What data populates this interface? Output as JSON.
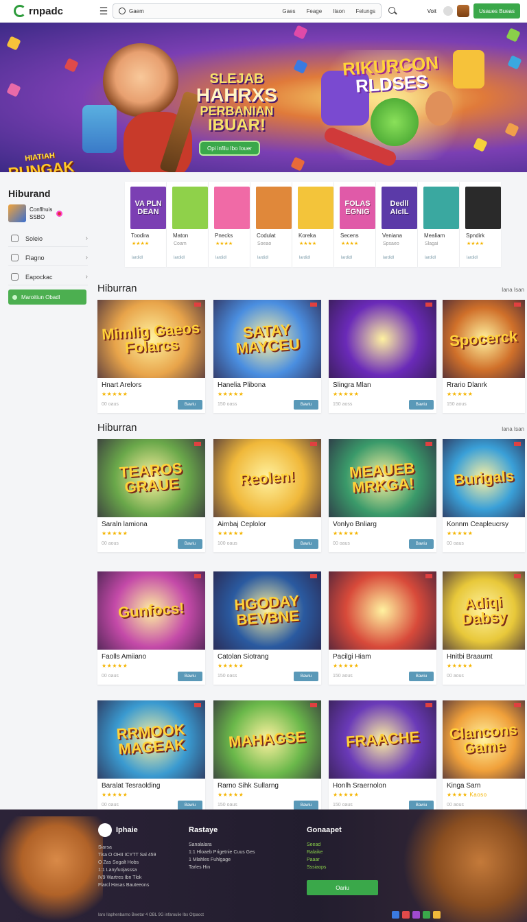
{
  "header": {
    "brand": "rnpadc",
    "search_placeholder": "Gaem",
    "nav_links": [
      "Gaes",
      "Feage",
      "Ilaon",
      "Felungs"
    ],
    "visit_label": "Voit",
    "cta_label": "Usaues Bueas"
  },
  "hero": {
    "badge_top": "HIATIAH",
    "badge_bottom": "RUNGAK",
    "title_lines": [
      "SLEJAB",
      "HAHRXS",
      "PERBANIAN",
      "IBUAR!"
    ],
    "button_label": "Opi infilu Ibo Iouer",
    "logo_lines": [
      "RIKURCON",
      "RLDSES"
    ]
  },
  "sidebar": {
    "title": "Hiburand",
    "user_name": "Conflhuis",
    "user_points": "SSBO",
    "items": [
      "Soleio",
      "Flagno",
      "Eapockac"
    ],
    "cta_label": "Maroitiun Obadl"
  },
  "featured": [
    {
      "art": "VA PLN DEAN",
      "name": "Toodira",
      "sub": "",
      "stars": "★★★★",
      "meta": "lardidl",
      "color": "#7b3fb3"
    },
    {
      "art": "",
      "name": "Maton",
      "sub": "Coam",
      "stars": "",
      "meta": "lardidl",
      "color": "#8fd14a"
    },
    {
      "art": "",
      "name": "Pnecks",
      "sub": "",
      "stars": "★★★★",
      "meta": "lardidl",
      "color": "#f06aa6"
    },
    {
      "art": "",
      "name": "Codulat",
      "sub": "Soeao",
      "stars": "",
      "meta": "lardidl",
      "color": "#e0883a"
    },
    {
      "art": "",
      "name": "Koreka",
      "sub": "",
      "stars": "★★★★",
      "meta": "lardidl",
      "color": "#f3c43a"
    },
    {
      "art": "FOLAS EGNIG",
      "name": "Secens",
      "sub": "",
      "stars": "★★★★",
      "meta": "lardidl",
      "color": "#e05aa8"
    },
    {
      "art": "Dedll AIcIL",
      "name": "Veniana",
      "sub": "Spsaeo",
      "stars": "",
      "meta": "lardidl",
      "color": "#5b3aa8"
    },
    {
      "art": "",
      "name": "Mealiam",
      "sub": "Slagai",
      "stars": "",
      "meta": "lardidl",
      "color": "#3aa8a0"
    },
    {
      "art": "",
      "name": "Spndirk",
      "sub": "",
      "stars": "★★★★",
      "meta": "lardidl",
      "color": "#2a2a2a"
    }
  ],
  "sections": [
    {
      "title": "Hiburran",
      "more": "Iana Isan",
      "cards": [
        {
          "art": "Mimlig Gaeos Folarcs",
          "title": "Hnart Arelors",
          "stars": "★★★★★",
          "plays": "00 oaus",
          "btn": "Bawiu",
          "bg": "#e8a44a"
        },
        {
          "art": "SATAY MAYCEU",
          "title": "Hanelia Plibona",
          "stars": "★★★★★",
          "plays": "150 oass",
          "btn": "Bawiu",
          "bg": "#4a8ee0"
        },
        {
          "art": "",
          "title": "Slingra Mlan",
          "stars": "★★★★★",
          "plays": "150 aoss",
          "btn": "Bawiu",
          "bg": "#6a2ab8"
        },
        {
          "art": "Spocerck",
          "title": "Rrario Dlanrk",
          "stars": "★★★★★",
          "plays": "150 aous",
          "btn": "",
          "bg": "#d0702a"
        }
      ]
    },
    {
      "title": "Hiburran",
      "more": "Iana Isan",
      "cards": [
        {
          "art": "TEAROS GRAUE",
          "title": "Saraln lamiona",
          "stars": "★★★★★",
          "plays": "00 aous",
          "btn": "Bawiu",
          "bg": "#6aa84a"
        },
        {
          "art": "Reolen!",
          "title": "Aimbaj Ceplolor",
          "stars": "★★★★★",
          "plays": "100 oaus",
          "btn": "Bawiu",
          "bg": "#f0b83a"
        },
        {
          "art": "MEAUEB MRKGA!",
          "title": "Vonlyo Bnliarg",
          "stars": "★★★★★",
          "plays": "00 oaus",
          "btn": "Bawiu",
          "bg": "#3a9a6a"
        },
        {
          "art": "Burigals",
          "title": "Konnm Ceapleucrsy",
          "stars": "★★★★★",
          "plays": "00 oaus",
          "btn": "",
          "bg": "#3aa0d8"
        }
      ]
    },
    {
      "title": "",
      "more": "",
      "cards": [
        {
          "art": "Gunfocs!",
          "title": "Faolls Amiiano",
          "stars": "★★★★★",
          "plays": "00 oaus",
          "btn": "Bawiu",
          "bg": "#c44aa8"
        },
        {
          "art": "HGODAY BEVBNE",
          "title": "Catolan Siotrang",
          "stars": "★★★★★",
          "plays": "150 oass",
          "btn": "Bawiu",
          "bg": "#2a5aa0"
        },
        {
          "art": "",
          "title": "Pacilgi Hiam",
          "stars": "★★★★★",
          "plays": "150 aous",
          "btn": "Bawiu",
          "bg": "#d84a3a"
        },
        {
          "art": "Adiqi Dabsy",
          "title": "Hnitbi Braaurnt",
          "stars": "★★★★★",
          "plays": "00 aous",
          "btn": "",
          "bg": "#e8c83a"
        }
      ]
    },
    {
      "title": "",
      "more": "",
      "cards": [
        {
          "art": "RRMOOK MAGEAK",
          "title": "Baralat Tesraolding",
          "stars": "★★★★★",
          "plays": "00 oaus",
          "btn": "Bawiu",
          "bg": "#3a9ad0"
        },
        {
          "art": "MAHAGSE",
          "title": "Rarno Sihk Sullarng",
          "stars": "★★★★★",
          "plays": "150 oaus",
          "btn": "Bawiu",
          "bg": "#6ab84a"
        },
        {
          "art": "FRAACHE",
          "title": "Honlh Sraernolon",
          "stars": "★★★★★",
          "plays": "150 oaus",
          "btn": "Bawiu",
          "bg": "#6a3ab8"
        },
        {
          "art": "Clancons Game",
          "title": "Kinga Sarn",
          "stars": "★★★★ Kaoso",
          "plays": "00 aous",
          "btn": "",
          "bg": "#f0a03a"
        }
      ]
    }
  ],
  "footer": {
    "brand": "Iphaie",
    "about_lines": [
      "Siarsa",
      "Tisa O OHII ICYTT Sal 459",
      "O Zas Sogalt Hobs",
      "1:1 Lanyfuojasssa",
      "IV9 Wartres Ibn Tlok",
      "Flarcl Hasas Bauteeons"
    ],
    "col2_title": "Rastaye",
    "col2_lines": [
      "Sanalalara",
      "1:1 Hloaeb Prigetnie Cuus Ges",
      "1 Mlahles Fuhlgage",
      "Tarles Hin"
    ],
    "col3_title": "Gonaapet",
    "col3_lines": [
      "Seead",
      "Ralaike",
      "Paaar",
      "Sssiaops"
    ],
    "col3_btn": "Oariu",
    "copyright": "Iaro Ilaphenbarno Bwetar 4 OBL 9G infaroulie Ibs Otpaoct"
  },
  "colors": {
    "accent": "#3aa84a",
    "button_blue": "#5a99b8"
  }
}
